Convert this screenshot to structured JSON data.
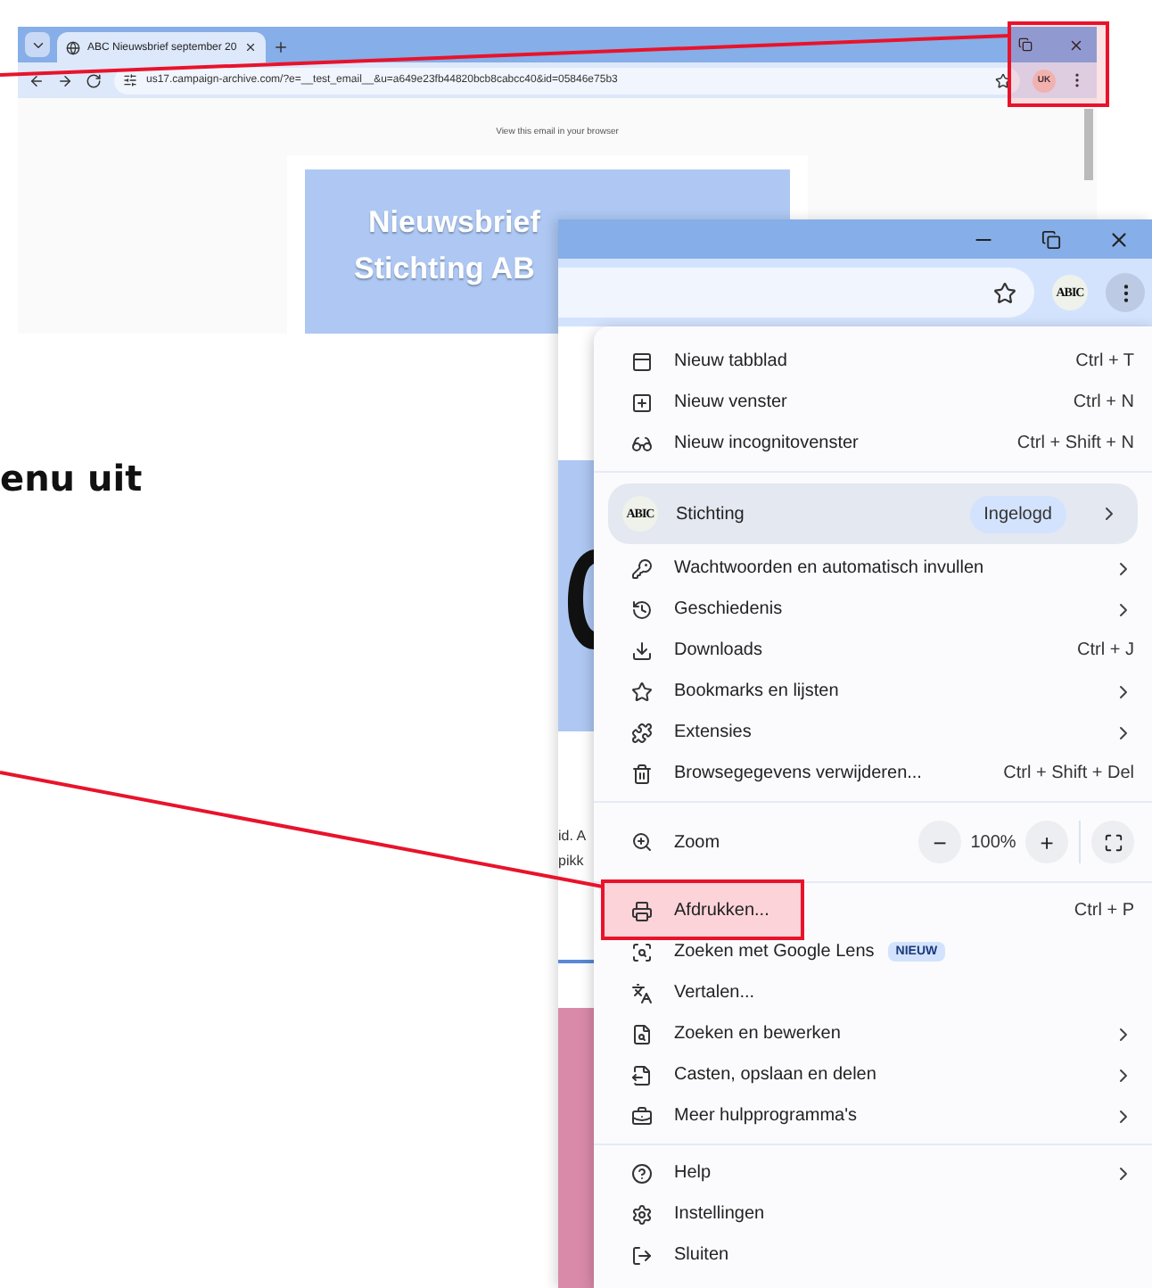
{
  "background_window": {
    "tab_title": "ABC Nieuwsbrief september 20",
    "url": "us17.campaign-archive.com/?e=__test_email__&u=a649e23fb44820bcb8cabcc40&id=05846e75b3",
    "avatar": "UK",
    "view_in_browser": "View this email in your browser",
    "banner_lines": [
      "Nieuwsbrief",
      "Stichting AB"
    ]
  },
  "instruction_fragment": "enu uit",
  "front_window": {
    "avatar": "ABIC",
    "page_fragments": [
      "id. A",
      "pikk"
    ]
  },
  "menu": {
    "items": [
      {
        "kind": "item",
        "label": "Nieuw tabblad",
        "shortcut": "Ctrl + T",
        "submenu": false,
        "highlighted": false
      },
      {
        "kind": "item",
        "label": "Nieuw venster",
        "shortcut": "Ctrl + N",
        "submenu": false,
        "highlighted": false
      },
      {
        "kind": "item",
        "label": "Nieuw incognitovenster",
        "shortcut": "Ctrl + Shift + N",
        "submenu": false,
        "highlighted": false
      },
      {
        "kind": "divider"
      },
      {
        "kind": "profile",
        "label": "Stichting",
        "avatar": "ABIC",
        "badge": "Ingelogd",
        "submenu": true,
        "highlighted": false
      },
      {
        "kind": "item",
        "label": "Wachtwoorden en automatisch invullen",
        "submenu": true,
        "highlighted": false
      },
      {
        "kind": "item",
        "label": "Geschiedenis",
        "submenu": true,
        "highlighted": false
      },
      {
        "kind": "item",
        "label": "Downloads",
        "shortcut": "Ctrl + J",
        "submenu": false,
        "highlighted": false
      },
      {
        "kind": "item",
        "label": "Bookmarks en lijsten",
        "submenu": true,
        "highlighted": false
      },
      {
        "kind": "item",
        "label": "Extensies",
        "submenu": true,
        "highlighted": false
      },
      {
        "kind": "item",
        "label": "Browsegegevens verwijderen...",
        "shortcut": "Ctrl + Shift + Del",
        "submenu": false,
        "highlighted": false
      },
      {
        "kind": "divider"
      },
      {
        "kind": "zoom",
        "label": "Zoom",
        "minus": "−",
        "value": "100%",
        "plus": "+",
        "highlighted": false
      },
      {
        "kind": "divider"
      },
      {
        "kind": "item",
        "label": "Afdrukken...",
        "shortcut": "Ctrl + P",
        "submenu": false,
        "highlighted": true
      },
      {
        "kind": "item",
        "label": "Zoeken met Google Lens",
        "badge": "NIEUW",
        "submenu": false,
        "highlighted": false
      },
      {
        "kind": "item",
        "label": "Vertalen...",
        "submenu": false,
        "highlighted": false
      },
      {
        "kind": "item",
        "label": "Zoeken en bewerken",
        "submenu": true,
        "highlighted": false
      },
      {
        "kind": "item",
        "label": "Casten, opslaan en delen",
        "submenu": true,
        "highlighted": false
      },
      {
        "kind": "item",
        "label": "Meer hulpprogramma's",
        "submenu": true,
        "highlighted": false
      },
      {
        "kind": "divider"
      },
      {
        "kind": "item",
        "label": "Help",
        "submenu": true,
        "highlighted": false
      },
      {
        "kind": "item",
        "label": "Instellingen",
        "submenu": false,
        "highlighted": false
      },
      {
        "kind": "item",
        "label": "Sluiten",
        "submenu": false,
        "highlighted": false
      }
    ]
  }
}
